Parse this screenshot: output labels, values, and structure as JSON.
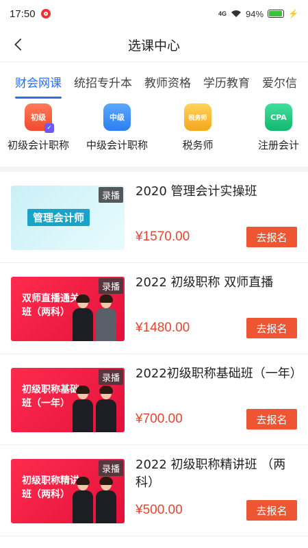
{
  "status": {
    "time": "17:50",
    "network": "4G",
    "battery": "94%",
    "battery_level": 0.94
  },
  "header": {
    "title": "选课中心",
    "back_icon": "chevron-left-icon"
  },
  "tabs": [
    {
      "label": "财会网课",
      "active": true
    },
    {
      "label": "统招专升本"
    },
    {
      "label": "教师资格"
    },
    {
      "label": "学历教育"
    },
    {
      "label": "爱尔信"
    }
  ],
  "categories": [
    {
      "label": "初级会计职称",
      "icon_text": "初级",
      "color": "#f04a2e"
    },
    {
      "label": "中级会计职称",
      "icon_text": "中级",
      "color": "#2d7ef0"
    },
    {
      "label": "税务师",
      "icon_text": "税务师",
      "color": "#f4a71e"
    },
    {
      "label": "注册会计",
      "icon_text": "CPA",
      "color": "#13b86f"
    }
  ],
  "courses": [
    {
      "title": "2020 管理会计实操班",
      "price": "¥1570.00",
      "badge": "录播",
      "cta": "去报名",
      "thumb_title": "管理会计师"
    },
    {
      "title": "2022 初级职称 双师直播",
      "price": "¥1480.00",
      "badge": "录播",
      "cta": "去报名",
      "thumb_title": "双师直播通关班（两科）"
    },
    {
      "title": "2022初级职称基础班（一年）",
      "price": "¥700.00",
      "badge": "录播",
      "cta": "去报名",
      "thumb_title": "初级职称基础班（一年）"
    },
    {
      "title": "2022 初级职称精讲班 （两科）",
      "price": "¥500.00",
      "badge": "录播",
      "cta": "去报名",
      "thumb_title": "初级职称精讲班（两科）"
    }
  ],
  "colors": {
    "accent": "#2c6cf0",
    "price": "#e8452e",
    "cta": "#ee5533"
  }
}
